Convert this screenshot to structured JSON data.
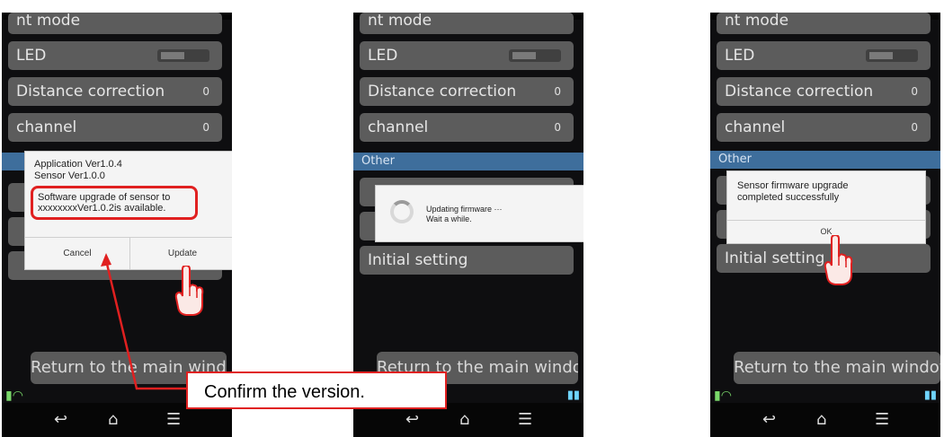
{
  "phone1": {
    "rows": {
      "mode": "nt mode",
      "led": "LED",
      "distance": "Distance correction",
      "channel": "channel",
      "distance_val": "0",
      "channel_val": "0"
    },
    "dialog": {
      "line1": "Application Ver1.0.4",
      "line2": "Sensor Ver1.0.0",
      "msg1": "Software upgrade of sensor to",
      "msg2": "xxxxxxxxVer1.0.2is available.",
      "cancel": "Cancel",
      "update": "Update"
    },
    "return_label": "Return to the main window"
  },
  "phone2": {
    "rows": {
      "mode": "nt mode",
      "led": "LED",
      "distance": "Distance correction",
      "channel": "channel",
      "distance_val": "0",
      "channel_val": "0"
    },
    "section": "Other",
    "dialog": {
      "line1": "Updating firmware ···",
      "line2": "Wait a while."
    },
    "initial": "Initial setting",
    "return_label": "Return to the main window"
  },
  "phone3": {
    "rows": {
      "mode": "nt mode",
      "led": "LED",
      "distance": "Distance correction",
      "channel": "channel",
      "distance_val": "0",
      "channel_val": "0"
    },
    "section": "Other",
    "dialog": {
      "line1": "Sensor firmware upgrade",
      "line2": "completed successfully",
      "ok": "OK"
    },
    "initial": "Initial setting",
    "return_label": "Return to the main window"
  },
  "callout": {
    "text": "Confirm the version."
  },
  "colors": {
    "accent": "#e02020",
    "section": "#3e6e9c",
    "row": "#5c5c5c"
  }
}
